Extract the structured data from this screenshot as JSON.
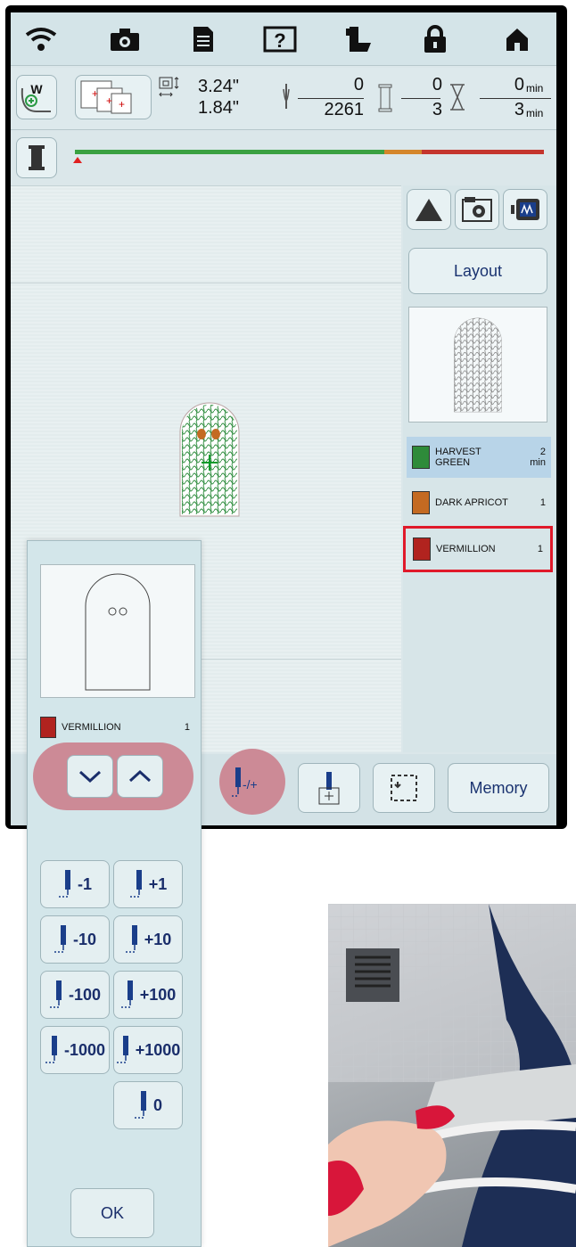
{
  "screen": {
    "status": {
      "width": "3.24\"",
      "height": "1.84\"",
      "stitch_current": "0",
      "stitch_total": "2261",
      "color_current": "0",
      "color_total": "3",
      "time_current": "0",
      "time_total": "3",
      "time_unit": "min"
    },
    "layout_label": "Layout",
    "memory_label": "Memory",
    "threads": [
      {
        "name1": "HARVEST",
        "name2": "GREEN",
        "count": "2",
        "unit": "min",
        "color": "#2e8b3a"
      },
      {
        "name1": "DARK APRICOT",
        "name2": "",
        "count": "1",
        "unit": "",
        "color": "#c46a22"
      },
      {
        "name1": "VERMILLION",
        "name2": "",
        "count": "1",
        "unit": "",
        "color": "#b1231f"
      }
    ],
    "progress_colors": [
      "#3aa142",
      "#d4862b",
      "#c4352d"
    ],
    "plus_minus": "-/+"
  },
  "panel": {
    "thread_name": "VERMILLION",
    "thread_count": "1",
    "buttons": [
      {
        "label": "-1"
      },
      {
        "label": "+1"
      },
      {
        "label": "-10"
      },
      {
        "label": "+10"
      },
      {
        "label": "-100"
      },
      {
        "label": "+100"
      },
      {
        "label": "-1000"
      },
      {
        "label": "+1000"
      },
      {
        "label": "0"
      }
    ],
    "ok_label": "OK"
  }
}
